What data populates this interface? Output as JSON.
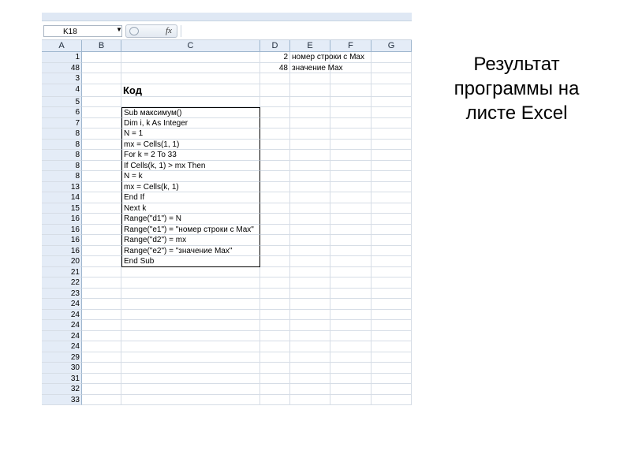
{
  "formula_bar": {
    "name_box": "K18",
    "fx": "fx",
    "formula": ""
  },
  "columns": [
    "A",
    "B",
    "C",
    "D",
    "E",
    "F",
    "G"
  ],
  "rows": [
    {
      "a": "1",
      "c": "",
      "d": "2",
      "e": "номер строки с Max"
    },
    {
      "a": "48",
      "c": "",
      "d": "48",
      "e": "значение Max"
    },
    {
      "a": "3",
      "c": "",
      "d": "",
      "e": ""
    },
    {
      "a": "4",
      "c": "Код",
      "d": "",
      "e": "",
      "title": true,
      "tall": true
    },
    {
      "a": "5",
      "c": "",
      "d": "",
      "e": ""
    },
    {
      "a": "6",
      "c": "Sub максимум()",
      "d": "",
      "e": "",
      "code": true
    },
    {
      "a": "7",
      "c": "Dim i, k As Integer",
      "d": "",
      "e": "",
      "code": true
    },
    {
      "a": "8",
      "c": "N = 1",
      "d": "",
      "e": "",
      "code": true
    },
    {
      "a": "8",
      "c": "mx = Cells(1, 1)",
      "d": "",
      "e": "",
      "code": true
    },
    {
      "a": "8",
      "c": "For k = 2 To 33",
      "d": "",
      "e": "",
      "code": true
    },
    {
      "a": "8",
      "c": "If Cells(k, 1) > mx Then",
      "d": "",
      "e": "",
      "code": true
    },
    {
      "a": "8",
      "c": "N = k",
      "d": "",
      "e": "",
      "code": true
    },
    {
      "a": "13",
      "c": "mx = Cells(k, 1)",
      "d": "",
      "e": "",
      "code": true
    },
    {
      "a": "14",
      "c": "End If",
      "d": "",
      "e": "",
      "code": true
    },
    {
      "a": "15",
      "c": "Next k",
      "d": "",
      "e": "",
      "code": true
    },
    {
      "a": "16",
      "c": "Range(\"d1\") = N",
      "d": "",
      "e": "",
      "code": true
    },
    {
      "a": "16",
      "c": "Range(\"e1\") = \"номер строки с Max\"",
      "d": "",
      "e": "",
      "code": true
    },
    {
      "a": "16",
      "c": "Range(\"d2\") = mx",
      "d": "",
      "e": "",
      "code": true
    },
    {
      "a": "16",
      "c": "Range(\"e2\") = \"значение  Max\"",
      "d": "",
      "e": "",
      "code": true
    },
    {
      "a": "20",
      "c": "End Sub",
      "d": "",
      "e": "",
      "code": true,
      "code_end": true
    },
    {
      "a": "21",
      "c": "",
      "d": "",
      "e": ""
    },
    {
      "a": "22",
      "c": "",
      "d": "",
      "e": ""
    },
    {
      "a": "23",
      "c": "",
      "d": "",
      "e": ""
    },
    {
      "a": "24",
      "c": "",
      "d": "",
      "e": ""
    },
    {
      "a": "24",
      "c": "",
      "d": "",
      "e": ""
    },
    {
      "a": "24",
      "c": "",
      "d": "",
      "e": ""
    },
    {
      "a": "24",
      "c": "",
      "d": "",
      "e": ""
    },
    {
      "a": "24",
      "c": "",
      "d": "",
      "e": ""
    },
    {
      "a": "29",
      "c": "",
      "d": "",
      "e": ""
    },
    {
      "a": "30",
      "c": "",
      "d": "",
      "e": ""
    },
    {
      "a": "31",
      "c": "",
      "d": "",
      "e": ""
    },
    {
      "a": "32",
      "c": "",
      "d": "",
      "e": ""
    },
    {
      "a": "33",
      "c": "",
      "d": "",
      "e": ""
    }
  ],
  "caption": [
    "Результат",
    "программы на",
    "листе Excel"
  ],
  "colors": {
    "header_bg": "#e4ecf7",
    "gridline": "#d6dde6"
  }
}
